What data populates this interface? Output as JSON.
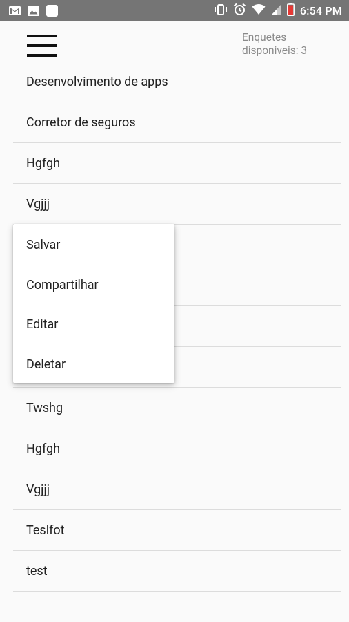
{
  "status_bar": {
    "time": "6:54 PM",
    "left_icons": [
      "gmail-icon",
      "image-icon",
      "blank-notification-icon"
    ],
    "right_icons": [
      "vibrate-icon",
      "alarm-icon",
      "wifi-icon",
      "signal-icon",
      "battery-icon"
    ]
  },
  "header": {
    "menu_icon": "hamburger-menu-icon",
    "counter_line1": "Enquetes",
    "counter_line2": "disponiveis: 3"
  },
  "list": {
    "items": [
      "Desenvolvimento de apps",
      "Corretor de seguros",
      "Hgfgh",
      "Vgjjj",
      "",
      "",
      "",
      "",
      "Twshg",
      "Hgfgh",
      "Vgjjj",
      "Teslfot",
      "test"
    ]
  },
  "popup_menu": {
    "items": [
      "Salvar",
      "Compartilhar",
      "Editar",
      "Deletar"
    ]
  },
  "colors": {
    "status_bar": "#757575",
    "background": "#fafafa",
    "divider": "#dcdcdc",
    "text": "#222222",
    "muted_text": "#8a8a8a",
    "battery_accent": "#e53935"
  }
}
